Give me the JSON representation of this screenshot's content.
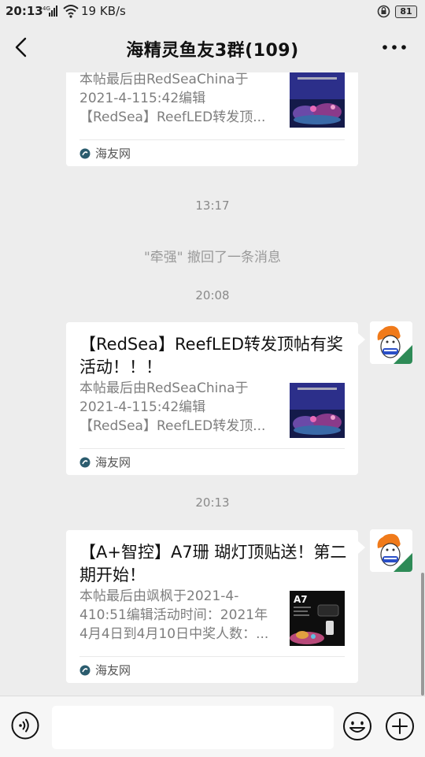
{
  "status_bar": {
    "time": "20:13",
    "network": "4G",
    "speed": "19 KB/s",
    "battery": "81"
  },
  "header": {
    "title": "海精灵鱼友3群(109)"
  },
  "messages": {
    "card_top": {
      "desc": "本帖最后由RedSeaChina于2021-4-115:42编辑【RedSea】ReefLED转发顶...",
      "source": "海友网"
    },
    "time1": "13:17",
    "recall": "\"牵强\" 撤回了一条消息",
    "time2": "20:08",
    "card1": {
      "title": "【RedSea】ReefLED转发顶帖有奖活动！！！",
      "desc": "本帖最后由RedSeaChina于2021-4-115:42编辑【RedSea】ReefLED转发顶...",
      "source": "海友网"
    },
    "time3": "20:13",
    "card2": {
      "title": "【A+智控】A7珊 瑚灯顶贴送！第二期开始！",
      "desc": "本帖最后由飒枫于2021-4-410:51编辑活动时间：2021年4月4日到4月10日中奖人数：...",
      "source": "海友网",
      "thumb_label": "A7"
    }
  },
  "colors": {
    "background": "#ededed",
    "card": "#ffffff",
    "muted_text": "#7e7e7e"
  }
}
